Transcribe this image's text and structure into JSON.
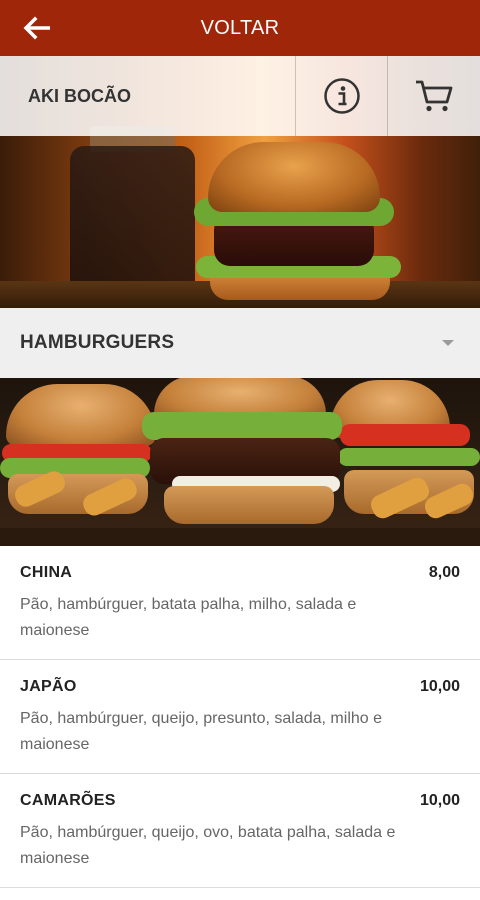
{
  "topbar": {
    "back_icon": "arrow-left-icon",
    "title": "VOLTAR",
    "color": "#a0260a"
  },
  "store": {
    "name": "AKI BOCÃO",
    "info_icon": "info-icon",
    "cart_icon": "cart-icon"
  },
  "category": {
    "selected": "HAMBURGUERS",
    "dropdown_icon": "caret-down-icon"
  },
  "products": [
    {
      "name": "CHINA",
      "price": "8,00",
      "description": "Pão, hambúrguer, batata palha, milho, salada e maionese"
    },
    {
      "name": "JAPÃO",
      "price": "10,00",
      "description": "Pão, hambúrguer, queijo, presunto, salada, milho e maionese"
    },
    {
      "name": "CAMARÕES",
      "price": "10,00",
      "description": "Pão, hambúrguer, queijo, ovo, batata palha, salada e maionese"
    }
  ]
}
